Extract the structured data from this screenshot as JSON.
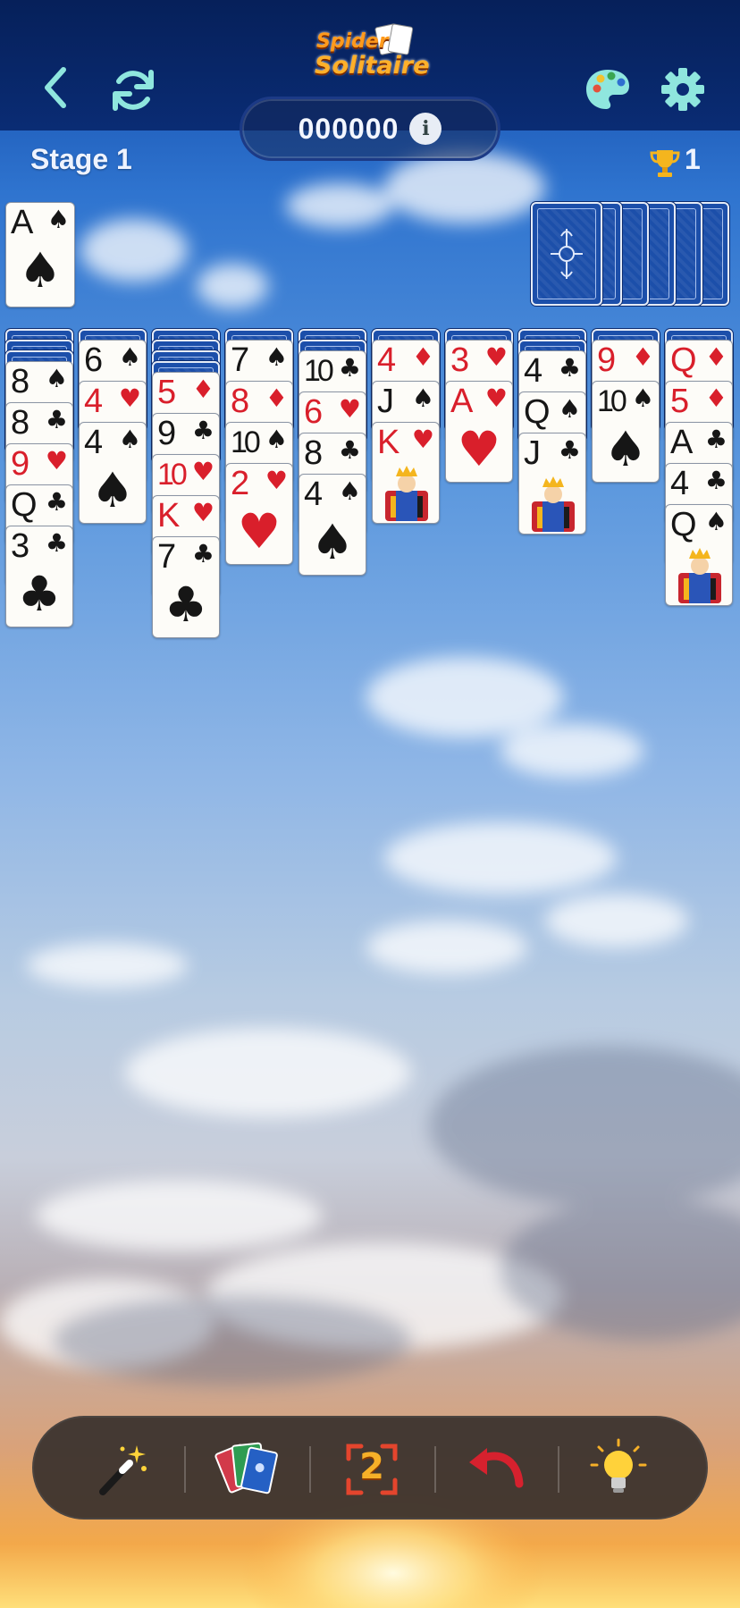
{
  "header": {
    "logo_line1": "Spider",
    "logo_line2": "Solitaire",
    "score": "000000",
    "info_symbol": "i",
    "stage_label": "Stage 1",
    "trophy_count": "1"
  },
  "foundation": [
    {
      "rank": "A",
      "suit": "♠",
      "color": "black"
    }
  ],
  "stock": {
    "remaining_deals": 6
  },
  "tableau": [
    {
      "hidden": 3,
      "cards": [
        {
          "rank": "8",
          "suit": "♠",
          "color": "black"
        },
        {
          "rank": "8",
          "suit": "♣",
          "color": "black"
        },
        {
          "rank": "9",
          "suit": "♥",
          "color": "red"
        },
        {
          "rank": "Q",
          "suit": "♣",
          "color": "black"
        },
        {
          "rank": "3",
          "suit": "♣",
          "color": "black"
        }
      ]
    },
    {
      "hidden": 1,
      "cards": [
        {
          "rank": "6",
          "suit": "♠",
          "color": "black"
        },
        {
          "rank": "4",
          "suit": "♥",
          "color": "red"
        },
        {
          "rank": "4",
          "suit": "♠",
          "color": "black"
        }
      ]
    },
    {
      "hidden": 4,
      "cards": [
        {
          "rank": "5",
          "suit": "♦",
          "color": "red"
        },
        {
          "rank": "9",
          "suit": "♣",
          "color": "black"
        },
        {
          "rank": "10",
          "suit": "♥",
          "color": "red"
        },
        {
          "rank": "K",
          "suit": "♥",
          "color": "red"
        },
        {
          "rank": "7",
          "suit": "♣",
          "color": "black"
        }
      ]
    },
    {
      "hidden": 1,
      "cards": [
        {
          "rank": "7",
          "suit": "♠",
          "color": "black"
        },
        {
          "rank": "8",
          "suit": "♦",
          "color": "red"
        },
        {
          "rank": "10",
          "suit": "♠",
          "color": "black"
        },
        {
          "rank": "2",
          "suit": "♥",
          "color": "red"
        }
      ]
    },
    {
      "hidden": 2,
      "cards": [
        {
          "rank": "10",
          "suit": "♣",
          "color": "black"
        },
        {
          "rank": "6",
          "suit": "♥",
          "color": "red"
        },
        {
          "rank": "8",
          "suit": "♣",
          "color": "black"
        },
        {
          "rank": "4",
          "suit": "♠",
          "color": "black"
        }
      ]
    },
    {
      "hidden": 1,
      "cards": [
        {
          "rank": "4",
          "suit": "♦",
          "color": "red"
        },
        {
          "rank": "J",
          "suit": "♠",
          "color": "black"
        },
        {
          "rank": "K",
          "suit": "♥",
          "color": "red",
          "face": true
        }
      ]
    },
    {
      "hidden": 1,
      "cards": [
        {
          "rank": "3",
          "suit": "♥",
          "color": "red"
        },
        {
          "rank": "A",
          "suit": "♥",
          "color": "red"
        }
      ]
    },
    {
      "hidden": 2,
      "cards": [
        {
          "rank": "4",
          "suit": "♣",
          "color": "black"
        },
        {
          "rank": "Q",
          "suit": "♠",
          "color": "black"
        },
        {
          "rank": "J",
          "suit": "♣",
          "color": "black",
          "face": true
        }
      ]
    },
    {
      "hidden": 1,
      "cards": [
        {
          "rank": "9",
          "suit": "♦",
          "color": "red"
        },
        {
          "rank": "10",
          "suit": "♠",
          "color": "black"
        }
      ]
    },
    {
      "hidden": 1,
      "cards": [
        {
          "rank": "Q",
          "suit": "♦",
          "color": "red"
        },
        {
          "rank": "5",
          "suit": "♦",
          "color": "red"
        },
        {
          "rank": "A",
          "suit": "♣",
          "color": "black"
        },
        {
          "rank": "4",
          "suit": "♣",
          "color": "black"
        },
        {
          "rank": "Q",
          "suit": "♠",
          "color": "black",
          "face": true
        }
      ]
    }
  ],
  "toolbar": {
    "magic_icon": "magic-wand-icon",
    "deal_icon": "deal-cards-icon",
    "double_label": "2",
    "undo_icon": "undo-arrow-icon",
    "hint_icon": "lightbulb-icon"
  },
  "colors": {
    "red_suit": "#d91f2b",
    "black_suit": "#161616",
    "card_back": "#1c4faa",
    "topbar": "#0a2c74"
  }
}
